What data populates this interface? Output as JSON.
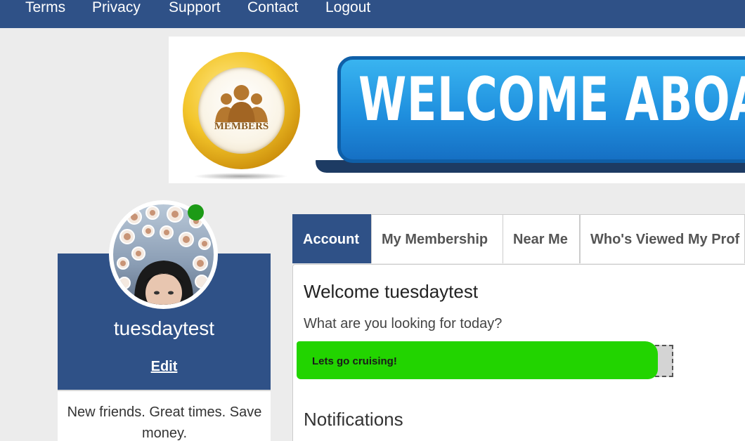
{
  "nav": {
    "items": [
      "Terms",
      "Privacy",
      "Support",
      "Contact",
      "Logout"
    ]
  },
  "banner": {
    "badge_text": "MEMBERS",
    "headline": "WELCOME ABOA"
  },
  "profile": {
    "username": "tuesdaytest",
    "edit_label": "Edit",
    "tagline": "New friends. Great times. Save money.",
    "online": true
  },
  "tabs": [
    {
      "label": "Account",
      "active": true
    },
    {
      "label": "My Membership",
      "active": false
    },
    {
      "label": "Near Me",
      "active": false
    },
    {
      "label": "Who's Viewed My Prof",
      "active": false
    }
  ],
  "main": {
    "welcome": "Welcome tuesdaytest",
    "question": "What are you looking for today?",
    "status_text": "Lets go cruising!",
    "notifications_title": "Notifications"
  },
  "colors": {
    "brand_blue": "#2f5187",
    "highlight_green": "#22d400",
    "online_green": "#1c9a16"
  }
}
